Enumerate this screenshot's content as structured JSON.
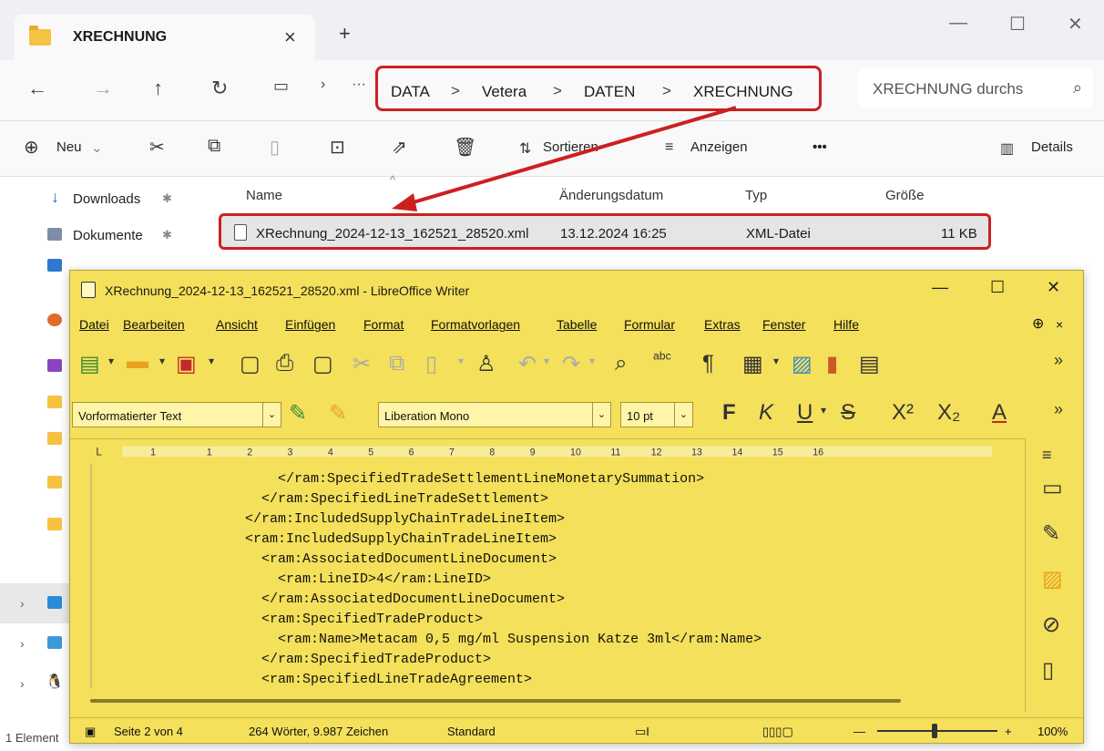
{
  "explorer": {
    "tab_title": "XRECHNUNG",
    "tab_close": "×",
    "new_tab": "+",
    "window_controls": [
      "—",
      "☐",
      "✕"
    ],
    "breadcrumb": [
      "DATA",
      "Vetera",
      "DATEN",
      "XRECHNUNG"
    ],
    "breadcrumb_sep": ">",
    "search_placeholder": "XRECHNUNG durchs",
    "commands": {
      "new": "Neu",
      "sort": "Sortieren",
      "view": "Anzeigen",
      "more": "•••",
      "details": "Details"
    },
    "sidebar": [
      {
        "label": "Downloads",
        "pin": "✱"
      },
      {
        "label": "Dokumente",
        "pin": "✱"
      }
    ],
    "columns": [
      "Name",
      "Änderungsdatum",
      "Typ",
      "Größe"
    ],
    "file": {
      "name": "XRechnung_2024-12-13_162521_28520.xml",
      "date": "13.12.2024 16:25",
      "type": "XML-Datei",
      "size": "11 KB"
    },
    "status": "1 Element"
  },
  "writer": {
    "title": "XRechnung_2024-12-13_162521_28520.xml - LibreOffice Writer",
    "window_controls": [
      "—",
      "☐",
      "✕"
    ],
    "menu": [
      "Datei",
      "Bearbeiten",
      "Ansicht",
      "Einfügen",
      "Format",
      "Formatvorlagen",
      "Tabelle",
      "Formular",
      "Extras",
      "Fenster",
      "Hilfe"
    ],
    "paragraph_style": "Vorformatierter Text",
    "font_name": "Liberation Mono",
    "font_size": "10 pt",
    "format_buttons": [
      "F",
      "K",
      "U"
    ],
    "ruler_numbers": [
      "1",
      "1",
      "2",
      "3",
      "4",
      "5",
      "6",
      "7",
      "8",
      "9",
      "10",
      "11",
      "12",
      "13",
      "14",
      "15",
      "16"
    ],
    "xml_lines": [
      "      </ram:SpecifiedTradeSettlementLineMonetarySummation>",
      "    </ram:SpecifiedLineTradeSettlement>",
      "  </ram:IncludedSupplyChainTradeLineItem>",
      "  <ram:IncludedSupplyChainTradeLineItem>",
      "    <ram:AssociatedDocumentLineDocument>",
      "      <ram:LineID>4</ram:LineID>",
      "    </ram:AssociatedDocumentLineDocument>",
      "    <ram:SpecifiedTradeProduct>",
      "      <ram:Name>Metacam 0,5 mg/ml Suspension Katze 3ml</ram:Name>",
      "    </ram:SpecifiedTradeProduct>",
      "    <ram:SpecifiedLineTradeAgreement>"
    ],
    "status": {
      "page": "Seite 2 von 4",
      "words": "264 Wörter, 9.987 Zeichen",
      "style": "Standard",
      "zoom": "100%"
    }
  }
}
